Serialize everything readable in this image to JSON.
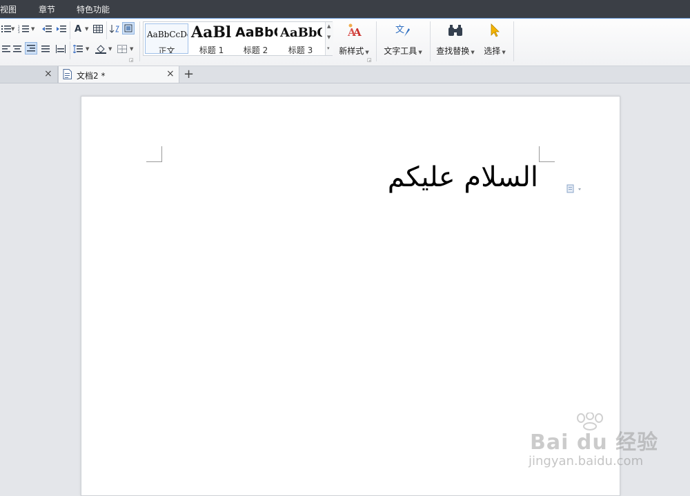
{
  "menubar": {
    "items": [
      "视图",
      "章节",
      "特色功能"
    ]
  },
  "ribbon": {
    "styles": [
      {
        "sample": "AaBbCcDd",
        "label": "正文"
      },
      {
        "sample": "AaBl",
        "label": "标题 1"
      },
      {
        "sample": "AaBbC",
        "label": "标题 2"
      },
      {
        "sample": "AaBbC",
        "label": "标题 3"
      }
    ],
    "new_style_label": "新样式",
    "text_tools_label": "文字工具",
    "find_replace_label": "查找替换",
    "select_label": "选择"
  },
  "tabs": {
    "active_title": "文档2 *",
    "new_tab_symbol": "+",
    "close_symbol": "×"
  },
  "document": {
    "text": "السلام عليكم"
  },
  "watermark": {
    "brand": "Bai du 经验",
    "url": "jingyan.baidu.com"
  },
  "colors": {
    "menubar_bg": "#3b3f46",
    "accent_blue": "#5b8fd1",
    "workspace_bg": "#e4e6ea"
  }
}
